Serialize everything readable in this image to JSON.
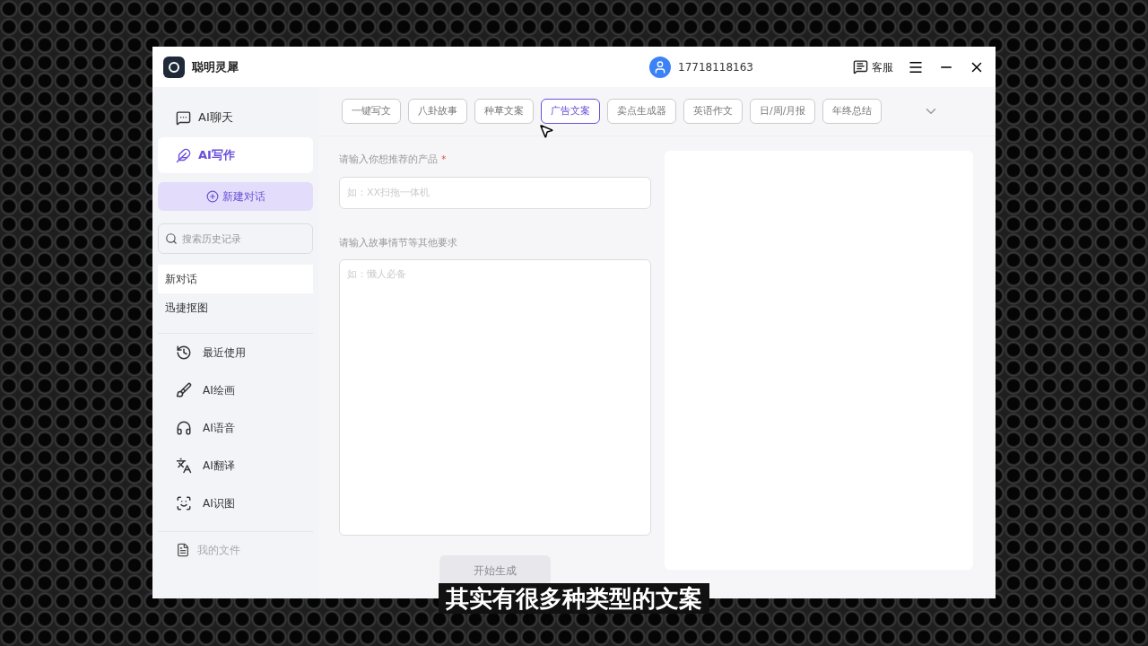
{
  "window": {
    "title": "聪明灵犀",
    "account": "17718118163",
    "service": "客服"
  },
  "sidebar": {
    "modes": [
      {
        "label": "AI聊天",
        "selected": false
      },
      {
        "label": "AI写作",
        "selected": true
      }
    ],
    "new_chat": "新建对话",
    "search": {
      "placeholder": "搜索历史记录"
    },
    "history": [
      {
        "label": "新对话",
        "selected": true
      },
      {
        "label": "迅捷抠图",
        "selected": false
      }
    ],
    "tools": [
      {
        "label": "最近使用"
      },
      {
        "label": "AI绘画"
      },
      {
        "label": "AI语音"
      },
      {
        "label": "AI翻译"
      },
      {
        "label": "AI识图"
      }
    ],
    "files": {
      "label": "我的文件",
      "disabled": true
    }
  },
  "tabs": [
    {
      "label": "一键写文",
      "selected": false
    },
    {
      "label": "八卦故事",
      "selected": false
    },
    {
      "label": "种草文案",
      "selected": false
    },
    {
      "label": "广告文案",
      "selected": true
    },
    {
      "label": "卖点生成器",
      "selected": false
    },
    {
      "label": "英语作文",
      "selected": false
    },
    {
      "label": "日/周/月报",
      "selected": false
    },
    {
      "label": "年终总结",
      "selected": false
    }
  ],
  "form": {
    "fields": [
      {
        "label": "请输入你想推荐的产品",
        "required_mark": "*",
        "placeholder": "如：XX扫拖一体机",
        "kind": "input"
      },
      {
        "label": "请输入故事情节等其他要求",
        "placeholder": "如：懒人必备",
        "kind": "textarea"
      }
    ],
    "submit": {
      "label": "开始生成",
      "disabled": true
    }
  },
  "subtitle": "其实有很多种类型的文案"
}
